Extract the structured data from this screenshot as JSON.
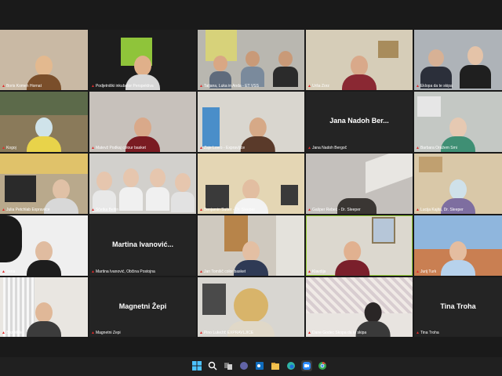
{
  "tiles": [
    {
      "label": "Boris Komen Hornat",
      "center": ""
    },
    {
      "label": "Podjetniški inkubator Perspektiva",
      "center": ""
    },
    {
      "label": "Tatjana, Luka in Anda - ET VSS",
      "center": ""
    },
    {
      "label": "Urša Zorz",
      "center": ""
    },
    {
      "label": "Eklopa da te skipa",
      "center": ""
    },
    {
      "label": "Kogoj",
      "center": ""
    },
    {
      "label": "Matevž Podkaj colour basket",
      "center": ""
    },
    {
      "label": "Žaje Lovro - Expravljice",
      "center": ""
    },
    {
      "label": "Jana Nadoh Bergoč",
      "center": "Jana Nadoh Ber..."
    },
    {
      "label": "Barbara Oražem Šmi",
      "center": ""
    },
    {
      "label": "Julia Petchlab Expraviice",
      "center": ""
    },
    {
      "label": "Sčetka Beltin",
      "center": ""
    },
    {
      "label": "Benjamin Sutter - Dr. Sleeper",
      "center": ""
    },
    {
      "label": "Gašper Rebec - Dr. Sleeper",
      "center": ""
    },
    {
      "label": "Lucija Kajita, Dr. Sleeper",
      "center": ""
    },
    {
      "label": "Irena",
      "center": ""
    },
    {
      "label": "Martina Ivanović, Občina Postojna",
      "center": "Martina  Ivanović..."
    },
    {
      "label": "Jan Tomšič color basket",
      "center": ""
    },
    {
      "label": "Klavdija",
      "center": ""
    },
    {
      "label": "Jurij Turk",
      "center": ""
    },
    {
      "label": "Boz Mele",
      "center": ""
    },
    {
      "label": "Magnetni Žepi",
      "center": "Magnetni Žepi"
    },
    {
      "label": "Pino Lukežič EXPRAVLJICE",
      "center": ""
    },
    {
      "label": "Dane Godec Skopa da te skipa",
      "center": ""
    },
    {
      "label": "Tina Troha",
      "center": "Tina Troha"
    }
  ],
  "colors": {
    "highlight": "#9ad13a",
    "mic_muted": "#e02b2b"
  },
  "taskbar": {
    "icons": [
      "windows-start-icon",
      "search-icon",
      "task-view-icon",
      "chat-icon",
      "outlook-icon",
      "file-explorer-icon",
      "edge-icon",
      "zoom-icon",
      "chrome-icon"
    ]
  }
}
